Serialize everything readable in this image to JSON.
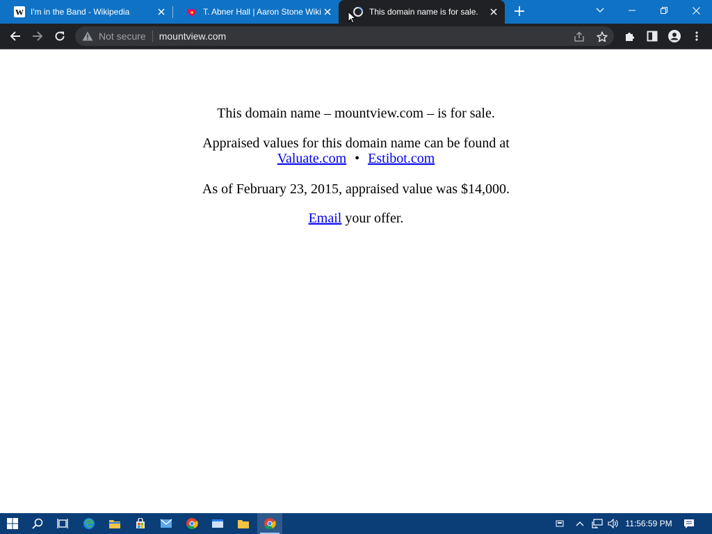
{
  "browser": {
    "tabs": [
      {
        "title": "I'm in the Band - Wikipedia",
        "icon": "wikipedia-icon",
        "active": false
      },
      {
        "title": "T. Abner Hall | Aaron Stone Wiki | Fandom",
        "icon": "fandom-icon",
        "active": false
      },
      {
        "title": "This domain name is for sale.",
        "icon": "loading-icon",
        "active": true
      }
    ],
    "address_bar": {
      "security_label": "Not secure",
      "url": "mountview.com"
    }
  },
  "page": {
    "line1": "This domain name – mountview.com – is for sale.",
    "line2": "Appraised values for this domain name can be found at",
    "link_valuate": "Valuate.com",
    "bullet": "•",
    "link_estibot": "Estibot.com",
    "line3": "As of February 23, 2015, appraised value was $14,000.",
    "email_link": "Email",
    "email_suffix": " your offer."
  },
  "taskbar": {
    "clock": "11:56:59 PM",
    "apps": [
      "start-icon",
      "search-icon",
      "task-view-icon",
      "edge-icon",
      "file-explorer-icon",
      "store-icon",
      "mail-icon",
      "chrome-icon",
      "app-icon",
      "folder-icon",
      "chrome-active-icon"
    ]
  },
  "colors": {
    "tabstrip": "#0f72c4",
    "toolbar": "#202124",
    "taskbar": "#0b3d77",
    "link": "#0000ee"
  }
}
